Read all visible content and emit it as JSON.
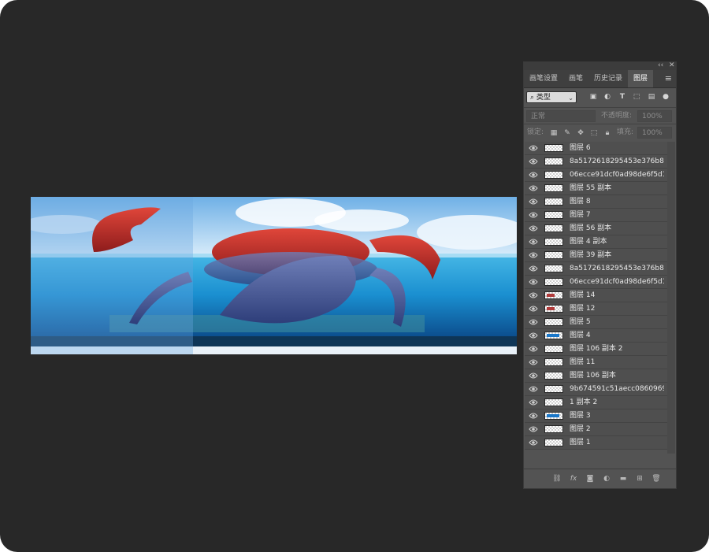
{
  "panel": {
    "collapse_icon": "double-chevron-left-icon",
    "close_icon": "close-icon",
    "tabs": [
      {
        "label": "画笔设置",
        "active": false
      },
      {
        "label": "画笔",
        "active": false
      },
      {
        "label": "历史记录",
        "active": false
      },
      {
        "label": "图层",
        "active": true
      }
    ],
    "filter": {
      "icon": "search-icon",
      "value": "类型"
    },
    "blend_mode": "正常",
    "opacity_label": "不透明度:",
    "opacity_value": "100%",
    "lock_label": "锁定:",
    "fill_label": "填充:",
    "fill_value": "100%",
    "layers": [
      {
        "name": "图层 6",
        "thumb": "empty"
      },
      {
        "name": "8a5172618295453e376b8f...",
        "thumb": "empty"
      },
      {
        "name": "06ecce91dcf0ad98de6f5d1...",
        "thumb": "empty"
      },
      {
        "name": "图层 55 副本",
        "thumb": "empty"
      },
      {
        "name": "图层 8",
        "thumb": "empty"
      },
      {
        "name": "图层 7",
        "thumb": "empty"
      },
      {
        "name": "图层 56 副本",
        "thumb": "empty"
      },
      {
        "name": "图层 4 副本",
        "thumb": "empty"
      },
      {
        "name": "图层 39 副本",
        "thumb": "empty"
      },
      {
        "name": "8a5172618295453e376b8f...",
        "thumb": "empty"
      },
      {
        "name": "06ecce91dcf0ad98de6f5d1...",
        "thumb": "empty"
      },
      {
        "name": "图层 14",
        "thumb": "crab"
      },
      {
        "name": "图层 12",
        "thumb": "crab"
      },
      {
        "name": "图层 5",
        "thumb": "empty"
      },
      {
        "name": "图层 4",
        "thumb": "water"
      },
      {
        "name": "图层 106 副本 2",
        "thumb": "empty"
      },
      {
        "name": "图层 11",
        "thumb": "empty"
      },
      {
        "name": "图层 106 副本",
        "thumb": "empty"
      },
      {
        "name": "9b674591c51aecc0860969...",
        "thumb": "empty"
      },
      {
        "name": "1 副本 2",
        "thumb": "empty"
      },
      {
        "name": "图层 3",
        "thumb": "water"
      },
      {
        "name": "图层 2",
        "thumb": "empty"
      },
      {
        "name": "图层 1",
        "thumb": "empty"
      }
    ],
    "bottom_icons": [
      "link-icon",
      "fx-icon",
      "mask-icon",
      "adjustment-icon",
      "folder-icon",
      "new-layer-icon",
      "trash-icon"
    ]
  },
  "colors": {
    "workspace": "#282828",
    "panel": "#535353",
    "accent": "#1a77c9"
  }
}
